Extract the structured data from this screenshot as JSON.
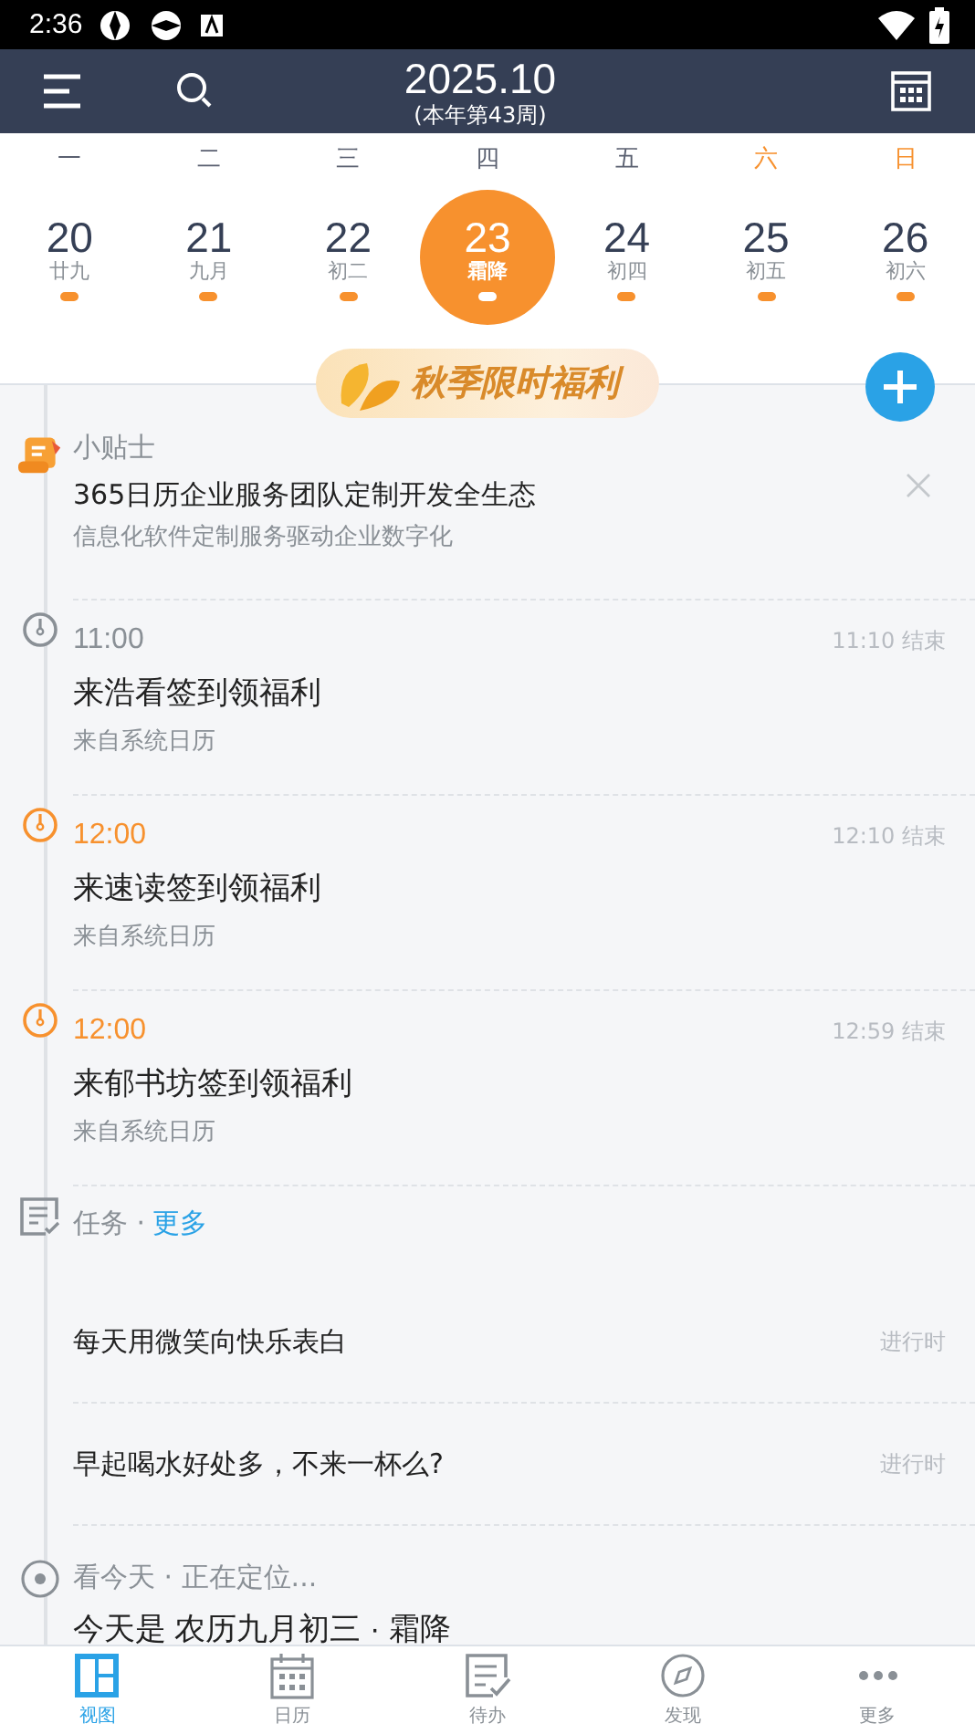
{
  "status_bar": {
    "time": "2:36"
  },
  "header": {
    "title": "2025.10",
    "subtitle": "(本年第43周)"
  },
  "weekdays": [
    {
      "label": "一",
      "weekend": false
    },
    {
      "label": "二",
      "weekend": false
    },
    {
      "label": "三",
      "weekend": false
    },
    {
      "label": "四",
      "weekend": false
    },
    {
      "label": "五",
      "weekend": false
    },
    {
      "label": "六",
      "weekend": true
    },
    {
      "label": "日",
      "weekend": true
    }
  ],
  "days": [
    {
      "day": "20",
      "lunar": "廿九",
      "selected": false
    },
    {
      "day": "21",
      "lunar": "九月",
      "selected": false
    },
    {
      "day": "22",
      "lunar": "初二",
      "selected": false
    },
    {
      "day": "23",
      "lunar": "霜降",
      "selected": true
    },
    {
      "day": "24",
      "lunar": "初四",
      "selected": false
    },
    {
      "day": "25",
      "lunar": "初五",
      "selected": false
    },
    {
      "day": "26",
      "lunar": "初六",
      "selected": false
    }
  ],
  "banner": "秋季限时福利",
  "tip": {
    "label": "小贴士",
    "title": "365日历企业服务团队定制开发全生态",
    "text": "信息化软件定制服务驱动企业数字化"
  },
  "events": [
    {
      "time": "11:00",
      "end": "11:10 结束",
      "title": "来浩看签到领福利",
      "source": "来自系统日历",
      "upcoming": false
    },
    {
      "time": "12:00",
      "end": "12:10 结束",
      "title": "来速读签到领福利",
      "source": "来自系统日历",
      "upcoming": true
    },
    {
      "time": "12:00",
      "end": "12:59 结束",
      "title": "来郁书坊签到领福利",
      "source": "来自系统日历",
      "upcoming": true
    }
  ],
  "tasks": {
    "label": "任务 ·",
    "more": "更多",
    "items": [
      {
        "title": "每天用微笑向快乐表白",
        "status": "进行时"
      },
      {
        "title": "早起喝水好处多，不来一杯么?",
        "status": "进行时"
      }
    ]
  },
  "today": {
    "label": "看今天 · 正在定位...",
    "text": "今天是 农历九月初三 · 霜降"
  },
  "nav": [
    {
      "label": "视图",
      "selected": true
    },
    {
      "label": "日历",
      "selected": false
    },
    {
      "label": "待办",
      "selected": false
    },
    {
      "label": "发现",
      "selected": false
    },
    {
      "label": "更多",
      "selected": false
    }
  ]
}
